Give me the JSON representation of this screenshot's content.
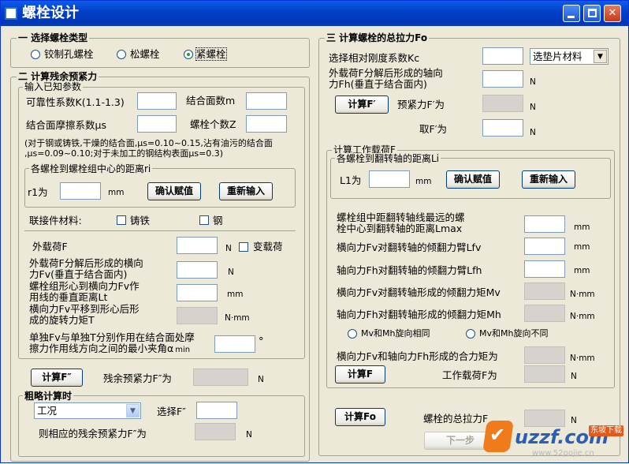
{
  "window": {
    "title": "螺栓设计"
  },
  "s1": {
    "title": "一 选择螺栓类型",
    "opt_reamed": "铰制孔螺栓",
    "opt_loose": "松螺栓",
    "opt_tight": "紧螺栓",
    "selected": "opt_tight"
  },
  "s2": {
    "title": "二 计算残余预紧力",
    "known_title": "输入已知参数",
    "reliability_label": "可靠性系数K(1.1-1.3)",
    "joint_count_label": "结合面数m",
    "friction_label": "结合面摩擦系数μs",
    "bolt_count_label": "螺栓个数Z",
    "note_line1": "(对于钢或铸铁,干燥的结合面,μs=0.10~0.15,沾有油污的结合面",
    "note_line2": ",μs=0.09~0.10;对于未加工的钢结构表面μs=0.3)",
    "dist_title": "各螺栓到螺栓组中心的距离ri",
    "r1_label": "r1为",
    "unit_mm": "mm",
    "confirm_btn": "确认赋值",
    "reinput_btn": "重新输入",
    "material_label": "联接件材料:",
    "cast_iron": "铸铁",
    "steel": "钢",
    "load_label": "外载荷F",
    "unit_N": "N",
    "variable_load": "变载荷",
    "fv_line1": "外载荷F分解后形成的横向",
    "fv_line2": "力Fv(垂直于结合面内)",
    "lt_line1": "螺栓组形心到横向力Fv作",
    "lt_line2": "用线的垂直距离Lt",
    "torque_line1": "横向力Fv平移到形心后形",
    "torque_line2": "成的旋转力矩T",
    "unit_Nmm": "N·mm",
    "angle_line1": "单独Fv与单独T分别作用在结合面处摩",
    "angle_line2": "擦力作用线方向之间的最小夹角α",
    "angle_sub": "min",
    "unit_deg": "°",
    "calc_btn": "计算F″",
    "residual_label": "残余预紧力F″为",
    "rough_title": "粗略计算时",
    "condition_value": "工况",
    "choose_label": "选择F″",
    "corr_label": "则相应的残余预紧力F″为"
  },
  "s3": {
    "title": "三 计算螺栓的总拉力Fo",
    "stiffness_label": "选择相对刚度系数Kc",
    "gasket_value": "选垫片材料",
    "fh_line1": "外载荷F分解后形成的轴向",
    "fh_line2": "力Fh(垂直于结合面内)",
    "calc_btn": "计算F′",
    "pre_label": "预紧力F′为",
    "take_label": "取F′为",
    "load_title": "计算工作载荷F",
    "li_title": "各螺栓到翻转轴的距离Li",
    "l1_label": "L1为",
    "confirm_btn": "确认赋值",
    "reinput_btn": "重新输入",
    "lmax_line1": "螺栓组中距翻转轴线最远的螺",
    "lmax_line2": "栓中心到翻转轴的距离Lmax",
    "lfv_label": "横向力Fv对翻转轴的倾翻力臂Lfv",
    "lfh_label": "轴向力Fh对翻转轴的倾翻力臂Lfh",
    "mv_label": "横向力Fv对翻转轴形成的倾翻力矩Mv",
    "mh_label": "轴向力Fh对翻转轴形成的倾翻力矩Mh",
    "same_dir": "Mv和Mh旋向相同",
    "diff_dir": "Mv和Mh旋向不同",
    "resultant_label": "横向力Fv和轴向力Fh形成的合力矩为",
    "calc_f_btn": "计算F",
    "work_load_label": "工作载荷F为",
    "calc_fo_btn": "计算Fo",
    "total_label": "螺栓的总拉力F",
    "next_btn": "下一步"
  },
  "watermark": {
    "brand": "uzzf.com",
    "tag": "东坡下载",
    "url": "www.52pojie.cn"
  }
}
